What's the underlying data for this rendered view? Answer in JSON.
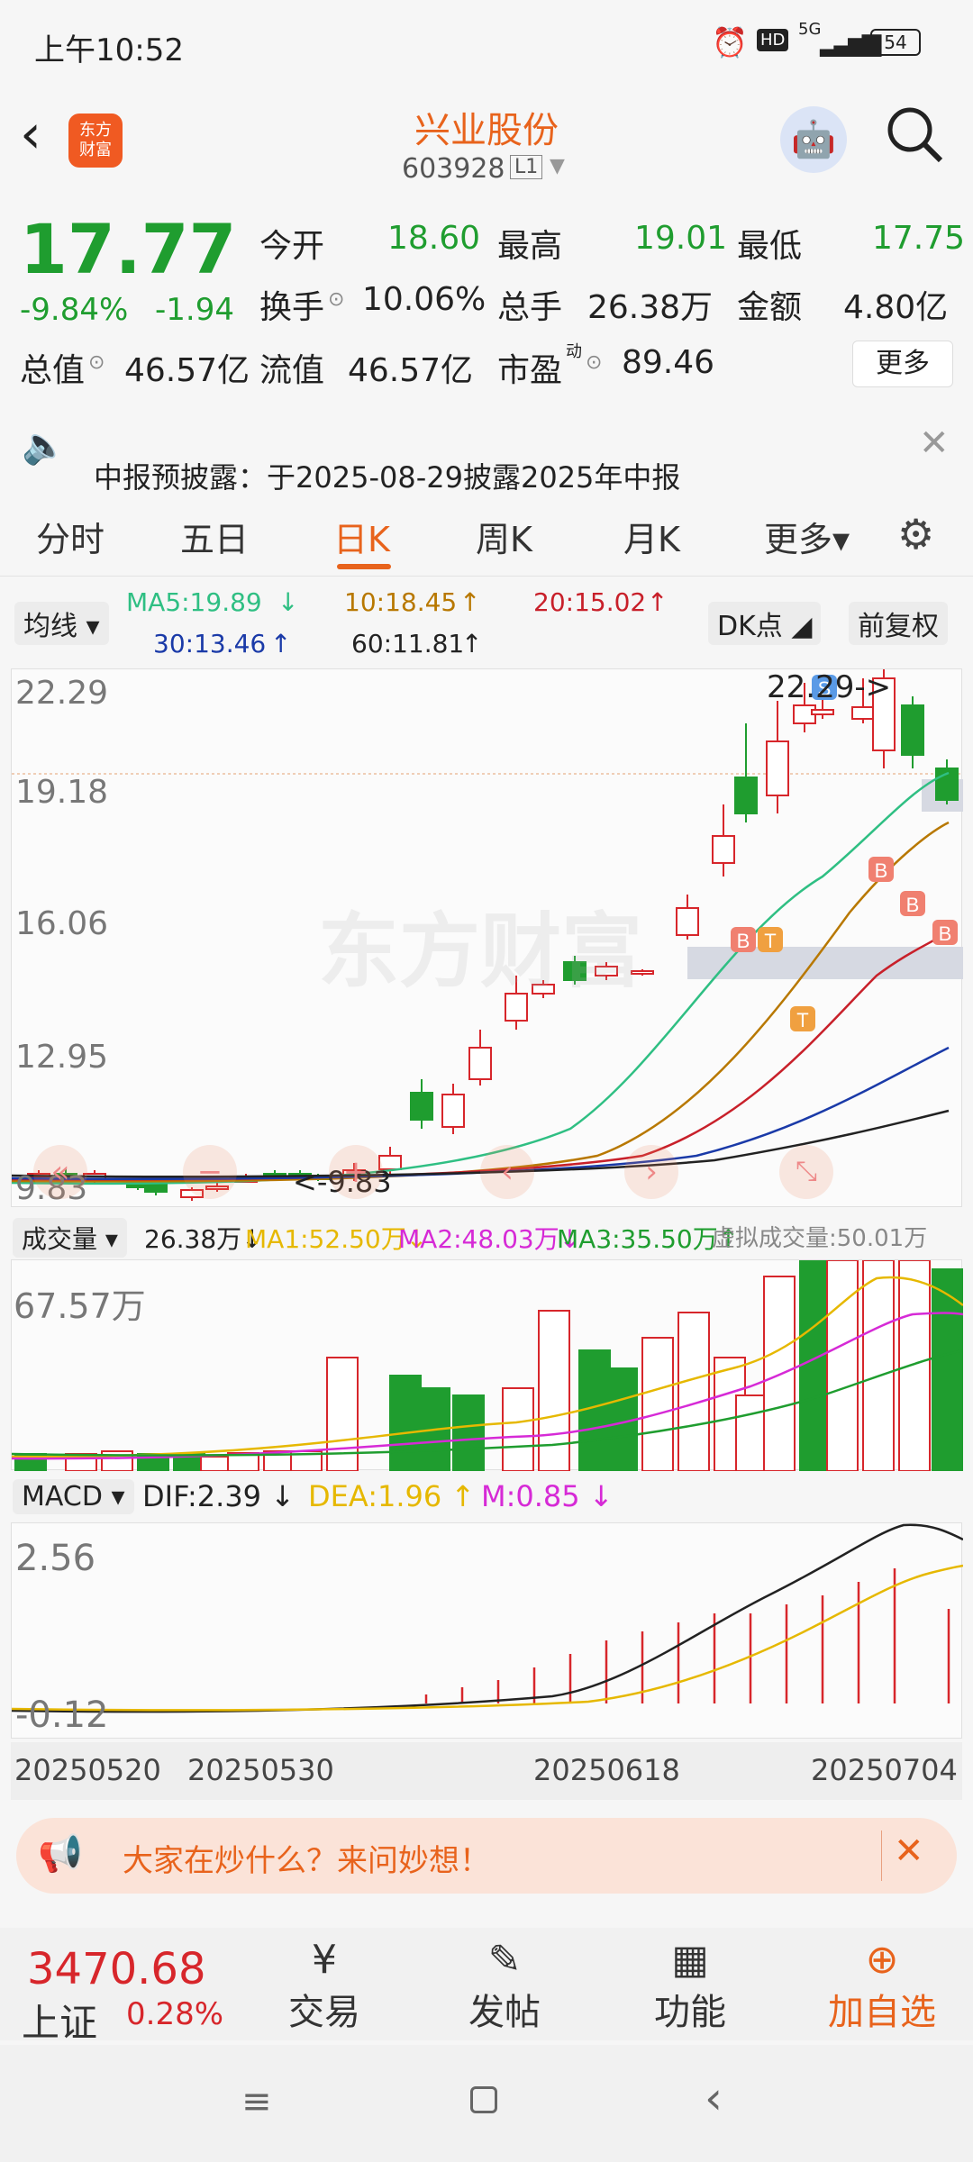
{
  "status": {
    "time": "上午10:52",
    "signal": "5G",
    "battery": "54",
    "hd": "HD"
  },
  "header": {
    "app_logo": "东方\n财富",
    "title": "兴业股份",
    "code": "603928",
    "level": "L1"
  },
  "quote": {
    "price": "17.77",
    "change_pct": "-9.84%",
    "change": "-1.94",
    "open_label": "今开",
    "open": "18.60",
    "high_label": "最高",
    "high": "19.01",
    "low_label": "最低",
    "low": "17.75",
    "turnover_label": "换手",
    "turnover": "10.06%",
    "volume_label": "总手",
    "volume": "26.38万",
    "amount_label": "金额",
    "amount": "4.80亿",
    "mktcap_label": "总值",
    "mktcap": "46.57亿",
    "float_label": "流值",
    "float": "46.57亿",
    "pe_label": "市盈",
    "pe_sup": "动",
    "pe": "89.46",
    "more": "更多"
  },
  "notice": {
    "text": "中报预披露：于2025-08-29披露2025年中报"
  },
  "tabs": [
    "分时",
    "五日",
    "日K",
    "周K",
    "月K",
    "更多▾"
  ],
  "ma": {
    "selector": "均线",
    "ma5": "MA5:19.89",
    "ma10": "10:18.45",
    "ma20": "20:15.02",
    "ma30": "30:13.46",
    "ma60": "60:11.81",
    "dk": "DK点",
    "fq": "前复权"
  },
  "kline": {
    "y_labels": [
      "22.29",
      "19.18",
      "16.06",
      "12.95",
      "9.83"
    ],
    "high_tag": "22.29->",
    "low_tag": "<-9.83",
    "watermark": "东方财富"
  },
  "volume": {
    "selector": "成交量",
    "vol": "26.38万",
    "ma1": "MA1:52.50万",
    "ma2": "MA2:48.03万",
    "ma3": "MA3:35.50万",
    "virtual": "虚拟成交量:50.01万",
    "max": "67.57万"
  },
  "macd": {
    "selector": "MACD",
    "dif": "DIF:2.39",
    "dea": "DEA:1.96",
    "m": "M:0.85",
    "top": "2.56",
    "bottom": "-0.12"
  },
  "dates": [
    "20250520",
    "20250530",
    "20250618",
    "20250704"
  ],
  "banner": {
    "text": "大家在炒什么？来问妙想！"
  },
  "bottom": {
    "index_value": "3470.68",
    "index_name": "上证",
    "index_pct": "0.28%",
    "trade": "交易",
    "post": "发帖",
    "func": "功能",
    "add": "加自选"
  },
  "colors": {
    "up": "#d7262b",
    "down": "#1f9d2f",
    "accent": "#e8631c"
  }
}
